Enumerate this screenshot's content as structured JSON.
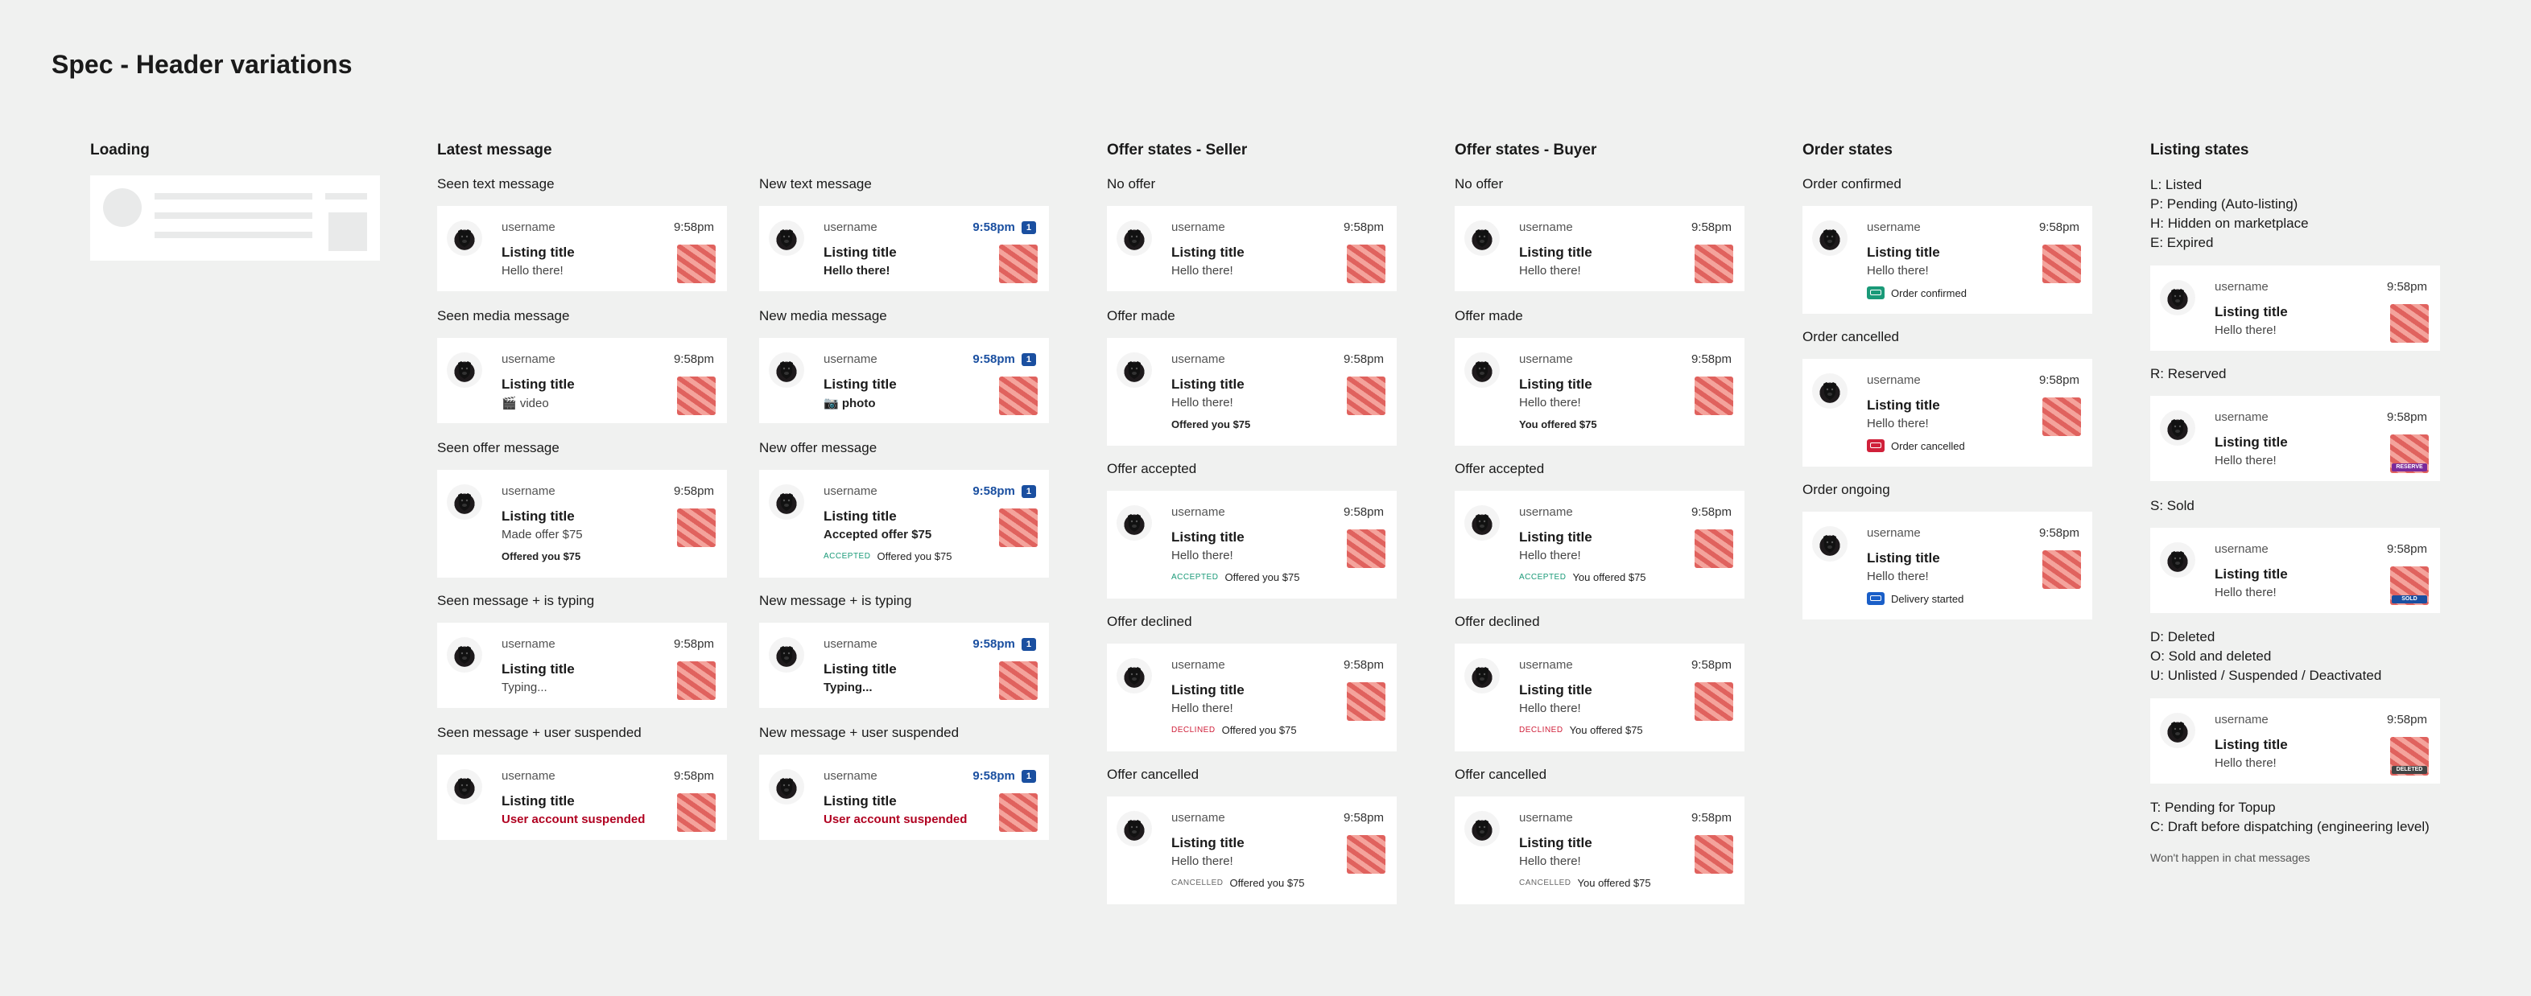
{
  "page_title": "Spec - Header variations",
  "card": {
    "username": "username",
    "time": "9:58pm",
    "listing_title": "Listing title",
    "hello": "Hello there!",
    "unread_count": "1"
  },
  "columns": {
    "loading": "Loading",
    "latest": "Latest message",
    "seller": "Offer states - Seller",
    "buyer": "Offer states - Buyer",
    "order": "Order states",
    "listing": "Listing states"
  },
  "latest": {
    "seen": [
      {
        "label": "Seen text message",
        "message": "Hello there!"
      },
      {
        "label": "Seen media message",
        "message": "🎬 video"
      },
      {
        "label": "Seen offer message",
        "message": "Made offer $75",
        "extra": "Offered you $75"
      },
      {
        "label": "Seen message + is typing",
        "message": "Typing..."
      },
      {
        "label": "Seen message + user suspended",
        "message": "User account suspended"
      }
    ],
    "new": [
      {
        "label": "New text message",
        "message": "Hello there!"
      },
      {
        "label": "New media message",
        "message": "📷 photo"
      },
      {
        "label": "New offer message",
        "message": "Accepted offer $75",
        "tag": "ACCEPTED",
        "extra": "Offered you $75"
      },
      {
        "label": "New message + is typing",
        "message": "Typing..."
      },
      {
        "label": "New message + user suspended",
        "message": "User account suspended"
      }
    ]
  },
  "seller": [
    {
      "label": "No offer"
    },
    {
      "label": "Offer made",
      "extra": "Offered you $75"
    },
    {
      "label": "Offer accepted",
      "tag": "ACCEPTED",
      "extra": "Offered you $75"
    },
    {
      "label": "Offer declined",
      "tag": "DECLINED",
      "extra": "Offered you $75"
    },
    {
      "label": "Offer cancelled",
      "tag": "CANCELLED",
      "extra": "Offered you $75"
    }
  ],
  "buyer": [
    {
      "label": "No offer"
    },
    {
      "label": "Offer made",
      "extra": "You offered $75"
    },
    {
      "label": "Offer accepted",
      "tag": "ACCEPTED",
      "extra": "You offered $75"
    },
    {
      "label": "Offer declined",
      "tag": "DECLINED",
      "extra": "You offered $75"
    },
    {
      "label": "Offer cancelled",
      "tag": "CANCELLED",
      "extra": "You offered $75"
    }
  ],
  "order": [
    {
      "label": "Order confirmed",
      "status": "Order confirmed",
      "color": "#1a9a78"
    },
    {
      "label": "Order cancelled",
      "status": "Order cancelled",
      "color": "#d0203a"
    },
    {
      "label": "Order ongoing",
      "status": "Delivery started",
      "color": "#1a5fc8"
    }
  ],
  "listing": {
    "legend1": [
      "L: Listed",
      "P: Pending (Auto-listing)",
      "H: Hidden on marketplace",
      "E: Expired"
    ],
    "label_reserved": "R: Reserved",
    "label_sold": "S: Sold",
    "legend2": [
      "D: Deleted",
      "O: Sold and deleted",
      "U: Unlisted / Suspended / Deactivated"
    ],
    "legend3": [
      "T: Pending for Topup",
      "C: Draft before dispatching (engineering level)"
    ],
    "note": "Won't happen in chat messages",
    "stamps": {
      "reserved": "RESERVE",
      "sold": "SOLD",
      "deleted": "DELETED"
    },
    "stamp_colors": {
      "reserved": "#7a2a9a",
      "sold": "#1a4fa0",
      "deleted": "#444444"
    }
  },
  "colors": {
    "accent": "#1a4fa0",
    "accepted": "#1a9a78",
    "declined": "#d0203a",
    "suspended": "#b00020"
  }
}
